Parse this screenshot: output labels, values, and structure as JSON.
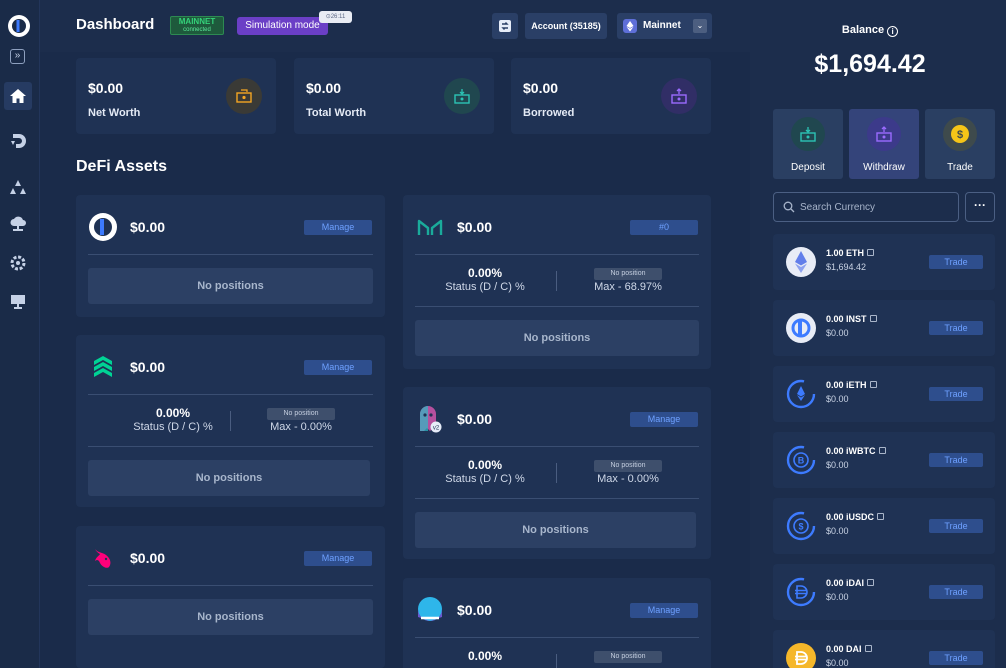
{
  "header": {
    "title": "Dashboard",
    "network_badge_top": "MAINNET",
    "network_badge_bottom": "connected",
    "sim_mode": "Simulation mode",
    "sim_timer": "⊙26:11",
    "account": "Account (35185)",
    "network": "Mainnet"
  },
  "stats": [
    {
      "value": "$0.00",
      "label": "Net Worth",
      "icon": "cash-icon",
      "color": "#f5a623"
    },
    {
      "value": "$0.00",
      "label": "Total Worth",
      "icon": "deposit-icon",
      "color": "#2bc3b4"
    },
    {
      "value": "$0.00",
      "label": "Borrowed",
      "icon": "withdraw-icon",
      "color": "#9b6bff"
    }
  ],
  "section_title": "DeFi Assets",
  "cards": {
    "instadapp": {
      "amount": "$0.00",
      "button": "Manage",
      "empty": "No positions"
    },
    "maker": {
      "amount": "$0.00",
      "button": "#0",
      "pct": "0.00%",
      "status": "Status (D / C) %",
      "badge": "No position",
      "max": "Max - 68.97%",
      "empty": "No positions"
    },
    "compound": {
      "amount": "$0.00",
      "button": "Manage",
      "pct": "0.00%",
      "status": "Status (D / C) %",
      "badge": "No position",
      "max": "Max - 0.00%",
      "empty": "No positions"
    },
    "aave": {
      "amount": "$0.00",
      "button": "Manage",
      "pct": "0.00%",
      "status": "Status (D / C) %",
      "badge": "No position",
      "max": "Max - 0.00%",
      "empty": "No positions",
      "version": "v2"
    },
    "uniswap": {
      "amount": "$0.00",
      "button": "Manage",
      "empty": "No positions"
    },
    "liquity": {
      "amount": "$0.00",
      "button": "Manage",
      "pct": "0.00%",
      "badge": "No position"
    }
  },
  "balance": {
    "title": "Balance",
    "info": "i",
    "value": "$1,694.42"
  },
  "actions": [
    {
      "label": "Deposit",
      "icon": "deposit-icon",
      "color": "#2bc3b4"
    },
    {
      "label": "Withdraw",
      "icon": "withdraw-icon",
      "color": "#9b6bff"
    },
    {
      "label": "Trade",
      "icon": "dollar-coin-icon",
      "color": "#f5c518"
    }
  ],
  "search": {
    "placeholder": "Search Currency"
  },
  "more": "···",
  "tokens": [
    {
      "amount": "1.00 ETH",
      "usd": "$1,694.42",
      "trade": "Trade",
      "icon": "eth-icon"
    },
    {
      "amount": "0.00 INST",
      "usd": "$0.00",
      "trade": "Trade",
      "icon": "inst-icon"
    },
    {
      "amount": "0.00 iETH",
      "usd": "$0.00",
      "trade": "Trade",
      "icon": "ieth-icon"
    },
    {
      "amount": "0.00 iWBTC",
      "usd": "$0.00",
      "trade": "Trade",
      "icon": "iwbtc-icon"
    },
    {
      "amount": "0.00 iUSDC",
      "usd": "$0.00",
      "trade": "Trade",
      "icon": "iusdc-icon"
    },
    {
      "amount": "0.00 iDAI",
      "usd": "$0.00",
      "trade": "Trade",
      "icon": "idai-icon"
    },
    {
      "amount": "0.00 DAI",
      "usd": "$0.00",
      "trade": "Trade",
      "icon": "dai-icon"
    }
  ],
  "colors": {
    "accent": "#2e4e8d",
    "accent_text": "#6ea0ff",
    "background": "#1c2d4c"
  }
}
